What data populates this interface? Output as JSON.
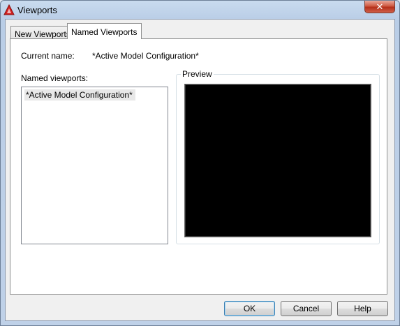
{
  "window": {
    "title": "Viewports",
    "close_label": "✕"
  },
  "tabs": [
    {
      "label": "New Viewports",
      "active": false
    },
    {
      "label": "Named Viewports",
      "active": true
    }
  ],
  "panel": {
    "current_name_label": "Current name:",
    "current_name_value": "*Active Model Configuration*",
    "named_viewports_label": "Named viewports:",
    "named_viewports": [
      "*Active Model Configuration*"
    ],
    "preview_label": "Preview"
  },
  "buttons": {
    "ok": "OK",
    "cancel": "Cancel",
    "help": "Help"
  },
  "colors": {
    "accent": "#3c7fb1",
    "preview_bg": "#000000",
    "close_red": "#c7432b"
  }
}
